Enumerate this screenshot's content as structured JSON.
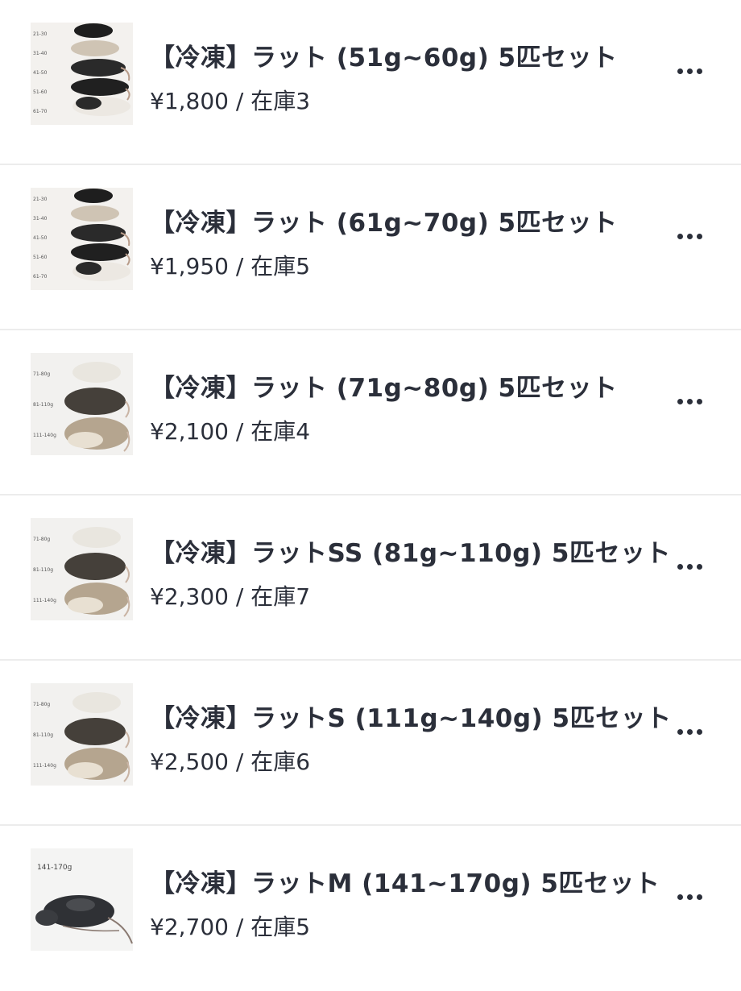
{
  "products": [
    {
      "title": "【冷凍】ラット (51g~60g) 5匹セット",
      "price": "¥1,800",
      "separator": " / ",
      "stock": "在庫3",
      "thumb_icon": "rat-stack-photo",
      "thumb_labels": [
        "21-30",
        "31-40",
        "41-50",
        "51-60",
        "61-70"
      ]
    },
    {
      "title": "【冷凍】ラット (61g~70g) 5匹セット",
      "price": "¥1,950",
      "separator": " / ",
      "stock": "在庫5",
      "thumb_icon": "rat-stack-photo",
      "thumb_labels": [
        "21-30",
        "31-40",
        "41-50",
        "51-60",
        "61-70"
      ]
    },
    {
      "title": "【冷凍】ラット (71g~80g) 5匹セット",
      "price": "¥2,100",
      "separator": " / ",
      "stock": "在庫4",
      "thumb_icon": "rat-trio-photo",
      "thumb_labels": [
        "71-80g",
        "81-110g",
        "111-140g"
      ]
    },
    {
      "title": "【冷凍】ラットSS (81g~110g) 5匹セット",
      "price": "¥2,300",
      "separator": " / ",
      "stock": "在庫7",
      "thumb_icon": "rat-trio-photo",
      "thumb_labels": [
        "71-80g",
        "81-110g",
        "111-140g"
      ]
    },
    {
      "title": "【冷凍】ラットS (111g~140g) 5匹セット",
      "price": "¥2,500",
      "separator": " / ",
      "stock": "在庫6",
      "thumb_icon": "rat-trio-photo",
      "thumb_labels": [
        "71-80g",
        "81-110g",
        "111-140g"
      ]
    },
    {
      "title": "【冷凍】ラットM (141~170g) 5匹セット",
      "price": "¥2,700",
      "separator": " / ",
      "stock": "在庫5",
      "thumb_icon": "rat-single-photo",
      "thumb_labels": [
        "141-170g"
      ]
    }
  ],
  "colors": {
    "text": "#2b2f3a",
    "divider": "#ececec",
    "background": "#ffffff"
  },
  "more_icon": "more-horizontal-icon"
}
